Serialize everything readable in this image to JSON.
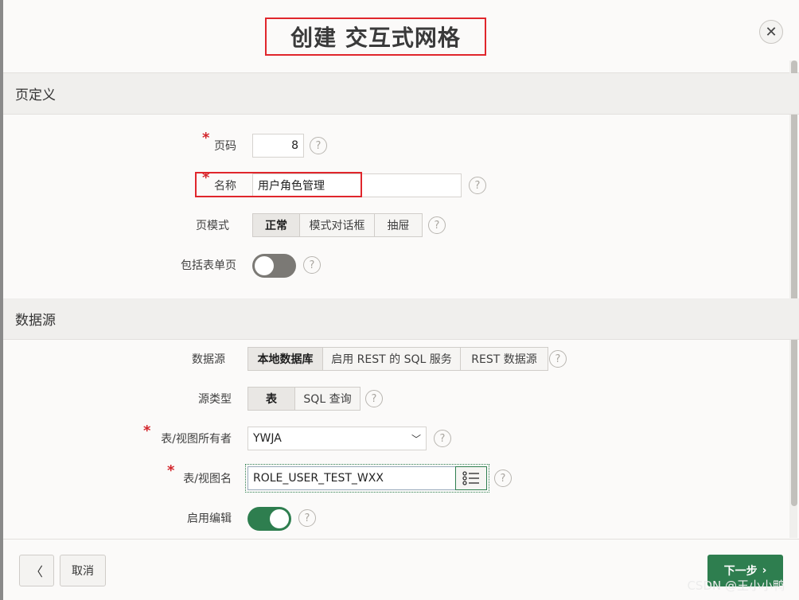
{
  "dialog": {
    "title": "创建 交互式网格",
    "close_icon": "close-icon"
  },
  "page_def": {
    "section_title": "页定义",
    "page_number_label": "页码",
    "page_number_value": "8",
    "name_label": "名称",
    "name_value": "用户角色管理",
    "page_mode_label": "页模式",
    "page_mode_options": [
      "正常",
      "模式对话框",
      "抽屉"
    ],
    "page_mode_selected": "正常",
    "include_form_label": "包括表单页",
    "include_form_on": false
  },
  "data_source": {
    "section_title": "数据源",
    "source_label": "数据源",
    "source_options": [
      "本地数据库",
      "启用 REST 的 SQL 服务",
      "REST 数据源"
    ],
    "source_selected": "本地数据库",
    "source_type_label": "源类型",
    "source_type_options": [
      "表",
      "SQL 查询"
    ],
    "source_type_selected": "表",
    "owner_label": "表/视图所有者",
    "owner_value": "YWJA",
    "table_name_label": "表/视图名",
    "table_name_value": "ROLE_USER_TEST_WXX",
    "enable_edit_label": "启用编辑",
    "enable_edit_on": true
  },
  "footer": {
    "back_icon": "chevron-left-icon",
    "cancel_label": "取消",
    "next_label": "下一步"
  },
  "help_icon": "?",
  "required_mark": "*",
  "watermark": "CSDN @王小小鸭",
  "colors": {
    "primary": "#2e7e4f",
    "highlight": "#e0262c",
    "required": "#d3262c"
  }
}
